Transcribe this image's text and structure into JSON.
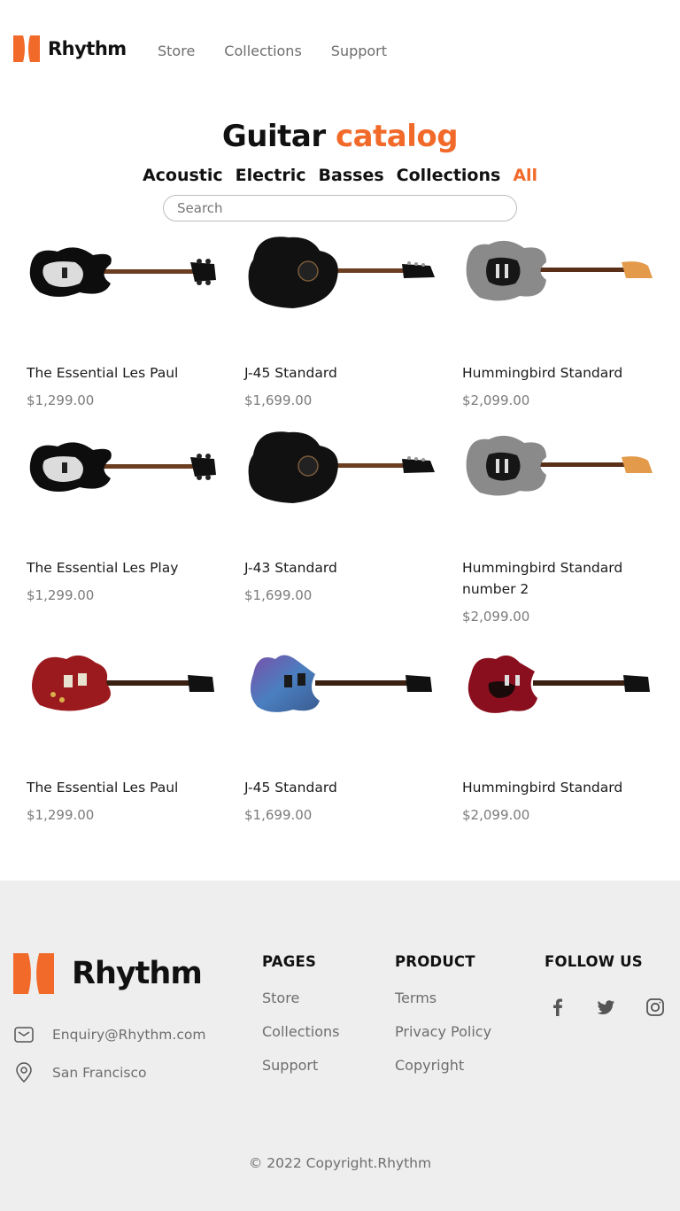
{
  "brand": {
    "name": "Rhythm",
    "accent": "#f26a2a"
  },
  "nav": [
    {
      "label": "Store"
    },
    {
      "label": "Collections"
    },
    {
      "label": "Support"
    }
  ],
  "catalog": {
    "title_main": "Guitar",
    "title_accent": "catalog",
    "categories": [
      {
        "label": "Acoustic"
      },
      {
        "label": "Electric"
      },
      {
        "label": "Basses"
      },
      {
        "label": "Collections"
      },
      {
        "label": "All"
      }
    ],
    "active_category": "All",
    "search_placeholder": "Search"
  },
  "products": [
    {
      "name": "The Essential Les Paul",
      "price": "$1,299.00",
      "image": "black-bass-guitar"
    },
    {
      "name": "J-45 Standard",
      "price": "$1,699.00",
      "image": "black-acoustic-guitar"
    },
    {
      "name": "Hummingbird Standard",
      "price": "$2,099.00",
      "image": "silver-stratocaster"
    },
    {
      "name": "The Essential Les Play",
      "price": "$1,299.00",
      "image": "black-bass-guitar"
    },
    {
      "name": "J-43 Standard",
      "price": "$1,699.00",
      "image": "black-acoustic-guitar"
    },
    {
      "name": "Hummingbird Standard number 2",
      "price": "$2,099.00",
      "image": "silver-stratocaster"
    },
    {
      "name": "The Essential Les Paul",
      "price": "$1,299.00",
      "image": "red-les-paul"
    },
    {
      "name": "J-45 Standard",
      "price": "$1,699.00",
      "image": "blue-sg-guitar"
    },
    {
      "name": "Hummingbird Standard",
      "price": "$2,099.00",
      "image": "red-double-cut"
    }
  ],
  "footer": {
    "email": "Enquiry@Rhythm.com",
    "location": "San Francisco",
    "pages": {
      "heading": "PAGES",
      "links": [
        "Store",
        "Collections",
        "Support"
      ]
    },
    "product": {
      "heading": "PRODUCT",
      "links": [
        "Terms",
        "Privacy Policy",
        "Copyright"
      ]
    },
    "follow": {
      "heading": "FOLLOW US",
      "icons": [
        "facebook-icon",
        "twitter-icon",
        "instagram-icon"
      ]
    },
    "copyright": "© 2022 Copyright.Rhythm"
  }
}
